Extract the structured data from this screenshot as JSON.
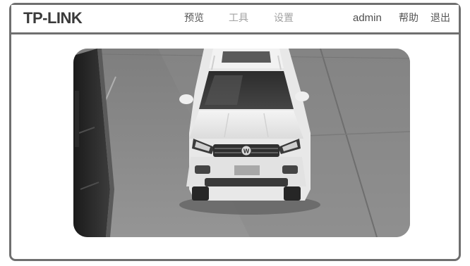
{
  "header": {
    "logo": "TP-LINK",
    "nav": [
      {
        "label": "预览",
        "active": true
      },
      {
        "label": "工具",
        "active": false
      },
      {
        "label": "设置",
        "active": false
      }
    ],
    "user": "admin",
    "help_label": "帮助",
    "logout_label": "退出"
  },
  "colors": {
    "frame_border": "#6f6f6f",
    "text_primary": "#4d4d4d",
    "text_muted": "#a3a3a3",
    "road": "#8c8c8c",
    "vehicle": "#eeeeee"
  },
  "video": {
    "content": "camera-feed-white-suv"
  }
}
